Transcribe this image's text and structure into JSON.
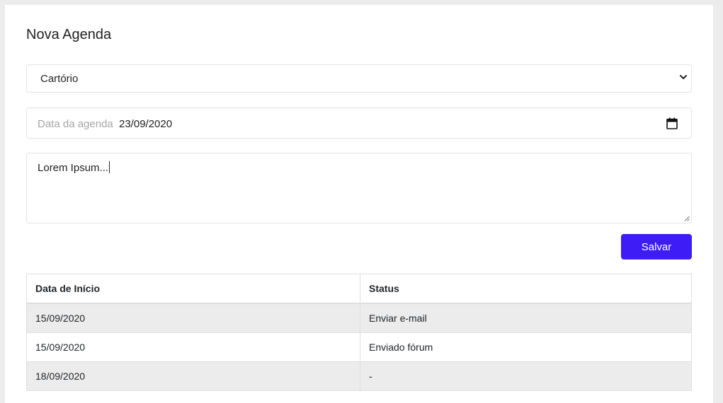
{
  "form": {
    "title": "Nova Agenda",
    "select": {
      "selected": "Cartório"
    },
    "date": {
      "label": "Data da agenda",
      "value": "23/09/2020"
    },
    "textarea": {
      "value": "Lorem Ipsum..."
    },
    "save_label": "Salvar"
  },
  "table": {
    "headers": [
      "Data de Início",
      "Status"
    ],
    "rows": [
      [
        "15/09/2020",
        "Enviar e-mail"
      ],
      [
        "15/09/2020",
        "Enviado fórum"
      ],
      [
        "18/09/2020",
        "-"
      ]
    ]
  },
  "colors": {
    "accent": "#3d1cf5",
    "background": "#ececec",
    "stripe": "#ececec"
  },
  "icons": {
    "select": "chevron-down-icon",
    "date": "calendar-icon",
    "textarea": "resize-grip-icon"
  }
}
